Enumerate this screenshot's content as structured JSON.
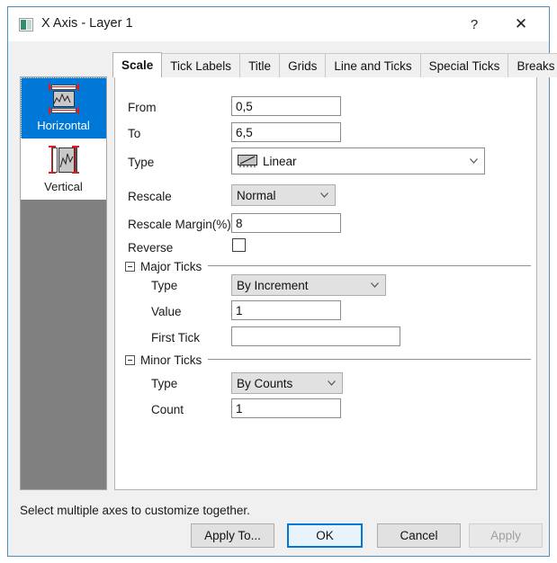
{
  "window": {
    "title": "X Axis - Layer 1",
    "icon": "axis-dialog-icon",
    "help_label": "?",
    "close_label": "✕"
  },
  "tabs": [
    {
      "label": "Scale",
      "active": true
    },
    {
      "label": "Tick Labels",
      "active": false
    },
    {
      "label": "Title",
      "active": false
    },
    {
      "label": "Grids",
      "active": false
    },
    {
      "label": "Line and Ticks",
      "active": false
    },
    {
      "label": "Special Ticks",
      "active": false
    },
    {
      "label": "Breaks",
      "active": false
    }
  ],
  "sidebar": {
    "items": [
      {
        "label": "Horizontal",
        "icon": "horizontal-axis-icon",
        "selected": true
      },
      {
        "label": "Vertical",
        "icon": "vertical-axis-icon",
        "selected": false
      }
    ]
  },
  "scale": {
    "from": {
      "label": "From",
      "value": "0,5"
    },
    "to": {
      "label": "To",
      "value": "6,5"
    },
    "type": {
      "label": "Type",
      "value": "Linear",
      "icon": "linear-scale-icon"
    },
    "rescale": {
      "label": "Rescale",
      "value": "Normal"
    },
    "rescale_margin": {
      "label": "Rescale Margin(%)",
      "value": "8"
    },
    "reverse": {
      "label": "Reverse",
      "checked": false
    }
  },
  "major_ticks": {
    "title": "Major Ticks",
    "type": {
      "label": "Type",
      "value": "By Increment"
    },
    "value": {
      "label": "Value",
      "value": "1"
    },
    "first_tick": {
      "label": "First Tick",
      "value": ""
    }
  },
  "minor_ticks": {
    "title": "Minor Ticks",
    "type": {
      "label": "Type",
      "value": "By Counts"
    },
    "count": {
      "label": "Count",
      "value": "1"
    }
  },
  "footer": {
    "hint": "Select multiple axes to customize together.",
    "buttons": {
      "apply_to": "Apply To...",
      "ok": "OK",
      "cancel": "Cancel",
      "apply": "Apply"
    }
  },
  "colors": {
    "accent": "#0078d7",
    "window_border": "#4a90c4",
    "sidebar_bg": "#808080"
  }
}
